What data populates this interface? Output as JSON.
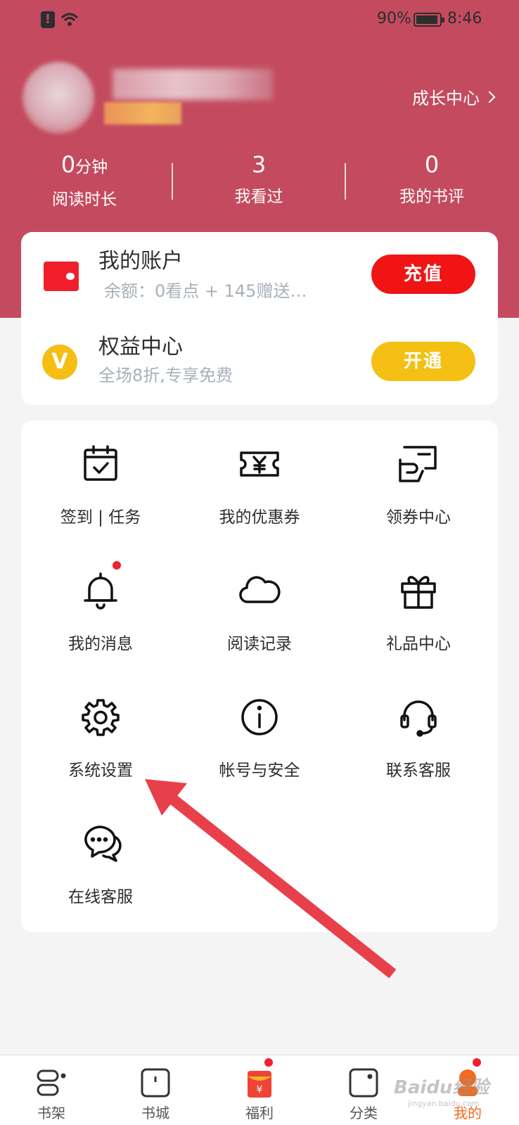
{
  "status_bar": {
    "battery": "90%",
    "time": "8:46"
  },
  "profile": {
    "growth_center": "成长中心"
  },
  "stats": [
    {
      "num": "0",
      "unit": "分钟",
      "label": "阅读时长"
    },
    {
      "num": "3",
      "unit": "",
      "label": "我看过"
    },
    {
      "num": "0",
      "unit": "",
      "label": "我的书评"
    }
  ],
  "account": {
    "title": "我的账户",
    "balance": "余额：0看点 + 145赠送…",
    "recharge": "充值"
  },
  "vip": {
    "title": "权益中心",
    "desc": "全场8折,专享免费",
    "open": "开通",
    "icon_letter": "V"
  },
  "menu": [
    {
      "label": "签到 | 任务",
      "icon": "calendar-check-icon"
    },
    {
      "label": "我的优惠券",
      "icon": "coupon-icon"
    },
    {
      "label": "领券中心",
      "icon": "coupon-hand-icon"
    },
    {
      "label": "我的消息",
      "icon": "bell-icon"
    },
    {
      "label": "阅读记录",
      "icon": "cloud-icon"
    },
    {
      "label": "礼品中心",
      "icon": "gift-icon"
    },
    {
      "label": "系统设置",
      "icon": "gear-icon"
    },
    {
      "label": "帐号与安全",
      "icon": "info-icon"
    },
    {
      "label": "联系客服",
      "icon": "headset-icon"
    },
    {
      "label": "在线客服",
      "icon": "chat-bubbles-icon"
    }
  ],
  "tabs": [
    {
      "label": "书架",
      "icon": "bookshelf-icon"
    },
    {
      "label": "书城",
      "icon": "book-icon"
    },
    {
      "label": "福利",
      "icon": "red-envelope-icon"
    },
    {
      "label": "分类",
      "icon": "category-icon"
    },
    {
      "label": "我的",
      "icon": "profile-icon"
    }
  ],
  "watermark": {
    "text": "Baidu经验",
    "sub": "jingyan.baidu.com"
  },
  "colors": {
    "hero": "#c44b5f",
    "recharge": "#f01414",
    "vip": "#f3c013",
    "active_tab": "#f26b1e",
    "arrow": "#e8404a"
  }
}
